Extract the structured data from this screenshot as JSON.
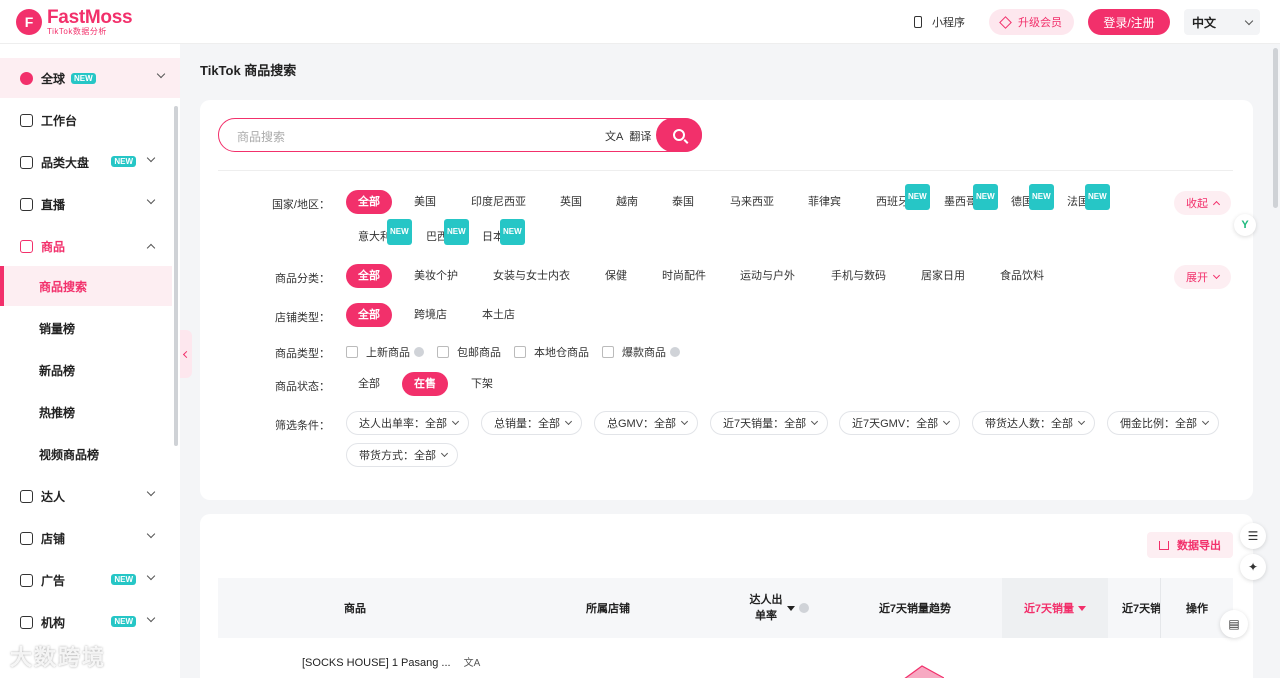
{
  "brand": {
    "name": "FastMoss",
    "subtitle": "TikTok数据分析"
  },
  "topbar": {
    "mini_program": "小程序",
    "upgrade": "升级会员",
    "login": "登录/注册",
    "language": "中文"
  },
  "sidebar": {
    "global": {
      "label": "全球",
      "badge": "NEW"
    },
    "items": [
      {
        "label": "工作台"
      },
      {
        "label": "品类大盘",
        "badge": "NEW"
      },
      {
        "label": "直播"
      },
      {
        "label": "商品"
      },
      {
        "label": "达人"
      },
      {
        "label": "店铺"
      },
      {
        "label": "广告",
        "badge": "NEW"
      },
      {
        "label": "机构",
        "badge": "NEW"
      }
    ],
    "sub_items": [
      "商品搜索",
      "销量榜",
      "新品榜",
      "热推榜",
      "视频商品榜"
    ]
  },
  "page": {
    "title": "TikTok 商品搜索"
  },
  "search": {
    "placeholder": "商品搜索",
    "translate": "翻译"
  },
  "filters": {
    "country_label": "国家/地区：",
    "countries": [
      "全部",
      "美国",
      "印度尼西亚",
      "英国",
      "越南",
      "泰国",
      "马来西亚",
      "菲律宾",
      "西班牙",
      "墨西哥",
      "德国",
      "法国",
      "意大利",
      "巴西",
      "日本"
    ],
    "new_badge": "NEW",
    "collapse": "收起",
    "category_label": "商品分类：",
    "categories": [
      "全部",
      "美妆个护",
      "女装与女士内衣",
      "保健",
      "时尚配件",
      "运动与户外",
      "手机与数码",
      "居家日用",
      "食品饮料"
    ],
    "expand": "展开",
    "shop_type_label": "店铺类型：",
    "shop_types": [
      "全部",
      "跨境店",
      "本土店"
    ],
    "product_type_label": "商品类型：",
    "product_types": [
      "上新商品",
      "包邮商品",
      "本地仓商品",
      "爆款商品"
    ],
    "status_label": "商品状态：",
    "statuses": [
      "全部",
      "在售",
      "下架"
    ],
    "conditions_label": "筛选条件：",
    "conditions": [
      "达人出单率：全部",
      "总销量：全部",
      "总GMV：全部",
      "近7天销量：全部",
      "近7天GMV：全部",
      "带货达人数：全部",
      "佣金比例：全部",
      "带货方式：全部"
    ]
  },
  "table": {
    "export": "数据导出",
    "headers": [
      "商品",
      "所属店铺",
      "达人出",
      "单率",
      "近7天销量趋势",
      "近7天销量",
      "近7天销",
      "操作"
    ],
    "row1_product": "[SOCKS HOUSE] 1 Pasang ..."
  },
  "watermark": "大数跨境",
  "colors": {
    "accent": "#f2306b",
    "new_badge": "#26c6c6"
  }
}
